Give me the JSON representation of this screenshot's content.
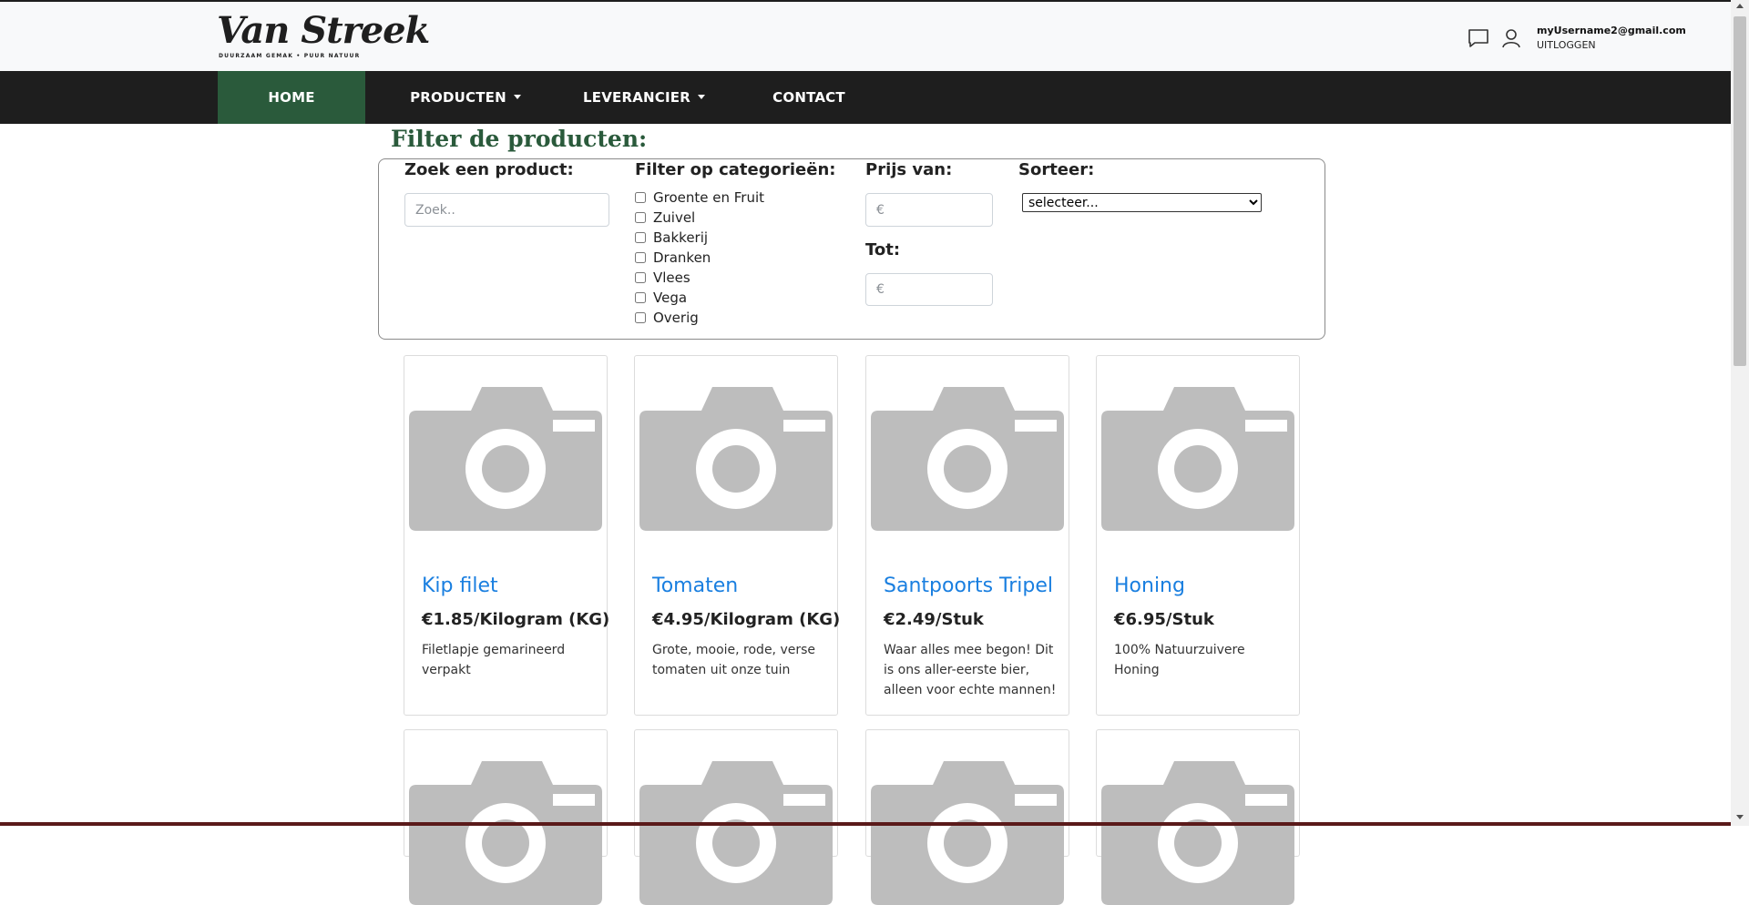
{
  "brand": {
    "name": "Van Streek",
    "tagline": "DUURZAAM GEMAK • PUUR NATUUR"
  },
  "header": {
    "chat_icon": "chat-bubble-icon",
    "user_icon": "user-icon",
    "email": "myUsername2@gmail.com",
    "logout": "UITLOGGEN"
  },
  "nav": {
    "home": "HOME",
    "producten": "PRODUCTEN",
    "leverancier": "LEVERANCIER",
    "contact": "CONTACT",
    "active_color": "#2a5a3b"
  },
  "filter": {
    "title": "Filter de producten:",
    "search_label": "Zoek een product:",
    "search_placeholder": "Zoek..",
    "categories_label": "Filter op categorieën:",
    "categories": [
      "Groente en Fruit",
      "Zuivel",
      "Bakkerij",
      "Dranken",
      "Vlees",
      "Vega",
      "Overig"
    ],
    "price_from_label": "Prijs van:",
    "price_from_placeholder": "€",
    "price_to_label": "Tot:",
    "price_to_placeholder": "€",
    "sort_label": "Sorteer:",
    "sort_selected": "selecteer..."
  },
  "products": [
    {
      "name": "Kip filet",
      "price": "€1.85/Kilogram (KG)",
      "description": "Filetlapje gemarineerd verpakt",
      "image_icon": "camera-placeholder-icon"
    },
    {
      "name": "Tomaten",
      "price": "€4.95/Kilogram (KG)",
      "description": "Grote, mooie, rode, verse tomaten uit onze tuin",
      "image_icon": "camera-placeholder-icon"
    },
    {
      "name": "Santpoorts Tripel",
      "price": "€2.49/Stuk",
      "description": "Waar alles mee begon! Dit is ons aller-eerste bier, alleen voor echte mannen!",
      "image_icon": "camera-placeholder-icon"
    },
    {
      "name": "Honing",
      "price": "€6.95/Stuk",
      "description": "100% Natuurzuivere Honing",
      "image_icon": "camera-placeholder-icon"
    }
  ],
  "colors": {
    "title_link": "#1a7fe0",
    "navbar": "#1e1e1e",
    "heading": "#2a5a3b"
  }
}
